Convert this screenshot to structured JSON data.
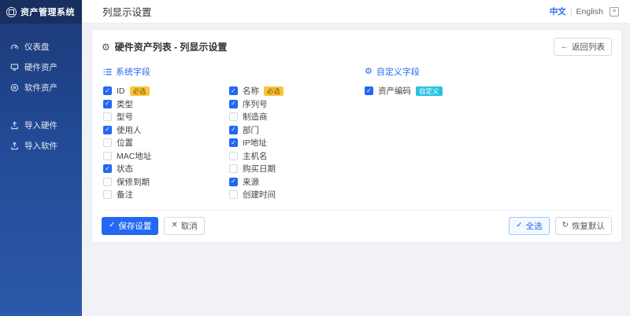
{
  "colors": {
    "accent": "#2468f2",
    "sidebar_top": "#1c3a78",
    "sidebar_bottom": "#2d59ac",
    "required_badge_bg": "#fbc53d",
    "custom_badge_bg": "#29c2e2",
    "content_bg": "#f0f2f5"
  },
  "sidebar": {
    "logo": {
      "icon": "asset-logo-icon",
      "title": "资产管理系统"
    },
    "items": [
      {
        "icon": "dashboard-icon",
        "label": "仪表盘",
        "gap_before": false
      },
      {
        "icon": "hardware-asset-icon",
        "label": "硬件资产",
        "gap_before": false
      },
      {
        "icon": "software-asset-icon",
        "label": "软件资产",
        "gap_before": false
      },
      {
        "icon": "import-hardware-icon",
        "label": "导入硬件",
        "gap_before": true
      },
      {
        "icon": "import-software-icon",
        "label": "导入软件",
        "gap_before": false
      }
    ]
  },
  "topbar": {
    "title": "列显示设置",
    "lang_zh": "中文",
    "lang_sep": "|",
    "lang_en": "English",
    "lang_icon": "language-icon"
  },
  "card": {
    "title_icon": "gear-icon",
    "title_icon_glyph": "⚙",
    "title": "硬件资产列表 - 列显示设置",
    "back_button": {
      "icon_glyph": "←",
      "label": "返回列表"
    },
    "system_section": {
      "icon": "list-icon",
      "label": "系统字段"
    },
    "custom_section": {
      "icon": "gear-icon",
      "icon_glyph": "⚙",
      "label": "自定义字段"
    },
    "system_fields_col1": [
      {
        "label": "ID",
        "checked": true,
        "badge": "必选",
        "badge_type": "required"
      },
      {
        "label": "类型",
        "checked": true
      },
      {
        "label": "型号",
        "checked": false
      },
      {
        "label": "使用人",
        "checked": true
      },
      {
        "label": "位置",
        "checked": false
      },
      {
        "label": "MAC地址",
        "checked": false
      },
      {
        "label": "状态",
        "checked": true
      },
      {
        "label": "保修到期",
        "checked": false
      },
      {
        "label": "备注",
        "checked": false
      }
    ],
    "system_fields_col2": [
      {
        "label": "名称",
        "checked": true,
        "badge": "必选",
        "badge_type": "required"
      },
      {
        "label": "序列号",
        "checked": true
      },
      {
        "label": "制造商",
        "checked": false
      },
      {
        "label": "部门",
        "checked": true
      },
      {
        "label": "IP地址",
        "checked": true
      },
      {
        "label": "主机名",
        "checked": false
      },
      {
        "label": "购买日期",
        "checked": false
      },
      {
        "label": "来源",
        "checked": true
      },
      {
        "label": "创建时间",
        "checked": false
      }
    ],
    "custom_fields": [
      {
        "label": "资产编码",
        "checked": true,
        "badge": "自定义",
        "badge_type": "custom"
      }
    ],
    "footer": {
      "save": {
        "icon_glyph": "✓",
        "label": "保存设置"
      },
      "cancel": {
        "icon_glyph": "✕",
        "label": "取消"
      },
      "select_all": {
        "icon_glyph": "✓",
        "label": "全选"
      },
      "restore": {
        "icon_glyph": "↻",
        "label": "恢复默认"
      }
    }
  }
}
